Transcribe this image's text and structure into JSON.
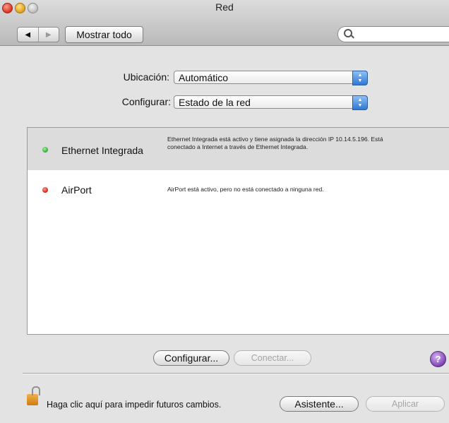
{
  "window": {
    "title": "Red"
  },
  "toolbar": {
    "back_glyph": "◀",
    "forward_glyph": "▶",
    "show_all_label": "Mostrar todo",
    "search_placeholder": ""
  },
  "form": {
    "location_label": "Ubicación:",
    "location_value": "Automático",
    "configure_label": "Configurar:",
    "configure_value": "Estado de la red"
  },
  "services": [
    {
      "name": "Ethernet Integrada",
      "status_color": "#2aa833",
      "description": "Ethernet Integrada está activo y tiene asignada la dirección IP 10.14.5.196. Está conectado a Internet a través de Ethernet Integrada.",
      "selected": true
    },
    {
      "name": "AirPort",
      "status_color": "#d12014",
      "description": "AirPort está activo, pero no está conectado a ninguna red.",
      "selected": false
    }
  ],
  "buttons": {
    "configure": "Configurar...",
    "connect": "Conectar...",
    "help": "?",
    "assistant": "Asistente...",
    "apply": "Aplicar"
  },
  "lock": {
    "text": "Haga clic aquí para impedir futuros cambios."
  }
}
